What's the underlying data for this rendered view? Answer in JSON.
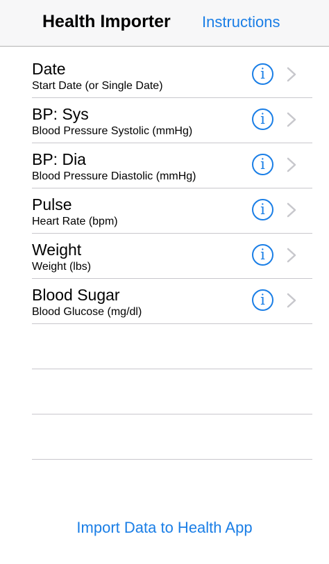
{
  "navbar": {
    "title": "Health Importer",
    "right_button": "Instructions"
  },
  "rows": [
    {
      "title": "Date",
      "subtitle": "Start Date (or Single Date)"
    },
    {
      "title": "BP: Sys",
      "subtitle": "Blood Pressure Systolic (mmHg)"
    },
    {
      "title": "BP: Dia",
      "subtitle": "Blood Pressure Diastolic (mmHg)"
    },
    {
      "title": "Pulse",
      "subtitle": "Heart Rate (bpm)"
    },
    {
      "title": "Weight",
      "subtitle": "Weight (lbs)"
    },
    {
      "title": "Blood Sugar",
      "subtitle": "Blood Glucose (mg/dl)"
    }
  ],
  "info_icon_glyph": "i",
  "bottom_button": "Import Data to Health App",
  "colors": {
    "accent": "#1a7ee6",
    "navbar_bg": "#f7f7f8",
    "separator": "#c8c7cc",
    "chevron": "#c7c7cc"
  },
  "icons": {
    "info": "info-circle-icon",
    "disclosure": "chevron-right-icon"
  }
}
